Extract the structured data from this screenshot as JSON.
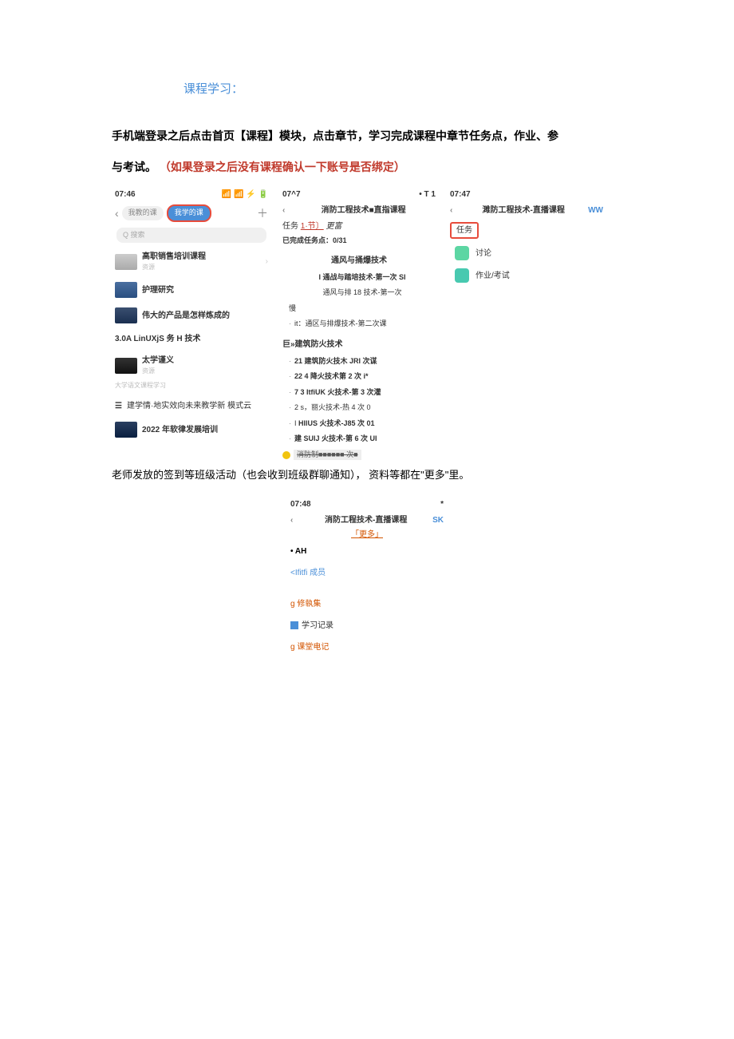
{
  "section_title": "课程学习：",
  "instruction_line1": "手机端登录之后点击首页【课程】模块，点击章节，学习完成课程中章节任务点，作业、参",
  "instruction_line2_a": "与考试。",
  "instruction_line2_b": "（如果登录之后没有课程确认一下账号是否绑定）",
  "screen1": {
    "time": "07:46",
    "signal": "📶 📶 ⚡ 🔋",
    "back": "‹",
    "tab1": "我教的课",
    "tab2": "我学的课",
    "plus": "＋",
    "search": "Q 搜索",
    "c1_title": "高职销售培训课程",
    "c1_sub": "资源",
    "arrow": "›",
    "c2_title": "护理研究",
    "c3_title": "伟大的产品是怎样炼成的",
    "c4_title": "3.0A LinUXjS 务 H 技术",
    "c5_title": "太学谨义",
    "c5_sub": "资源",
    "c5_note": "大学语文课程学习",
    "folder_icon": "☰",
    "folder_text": "建学情·地实效向未来教学新 模式云",
    "c6_title": "2022 年软律发展培训"
  },
  "screen2": {
    "time_l": "07^7",
    "time_r": "• T 1",
    "back": "‹",
    "title": "消防工程技术■直指课程",
    "task_label": "任务",
    "task_link": "1·节〕",
    "task_more": "更富",
    "progress": "已完成任务点：0/31",
    "ch1_h": "通风与捅爆技术",
    "ch1_1": "I 通战与踏培技术-第一次 SI",
    "ch1_2": "通风与排 18 技术-第一次",
    "slow": "慢",
    "ch1_3": "it：通区与排爆技术-第二次课",
    "ch2_h": "巨»建筑防火技术",
    "ch2_1": "21 建筑防火技木 JRI 次谋",
    "ch2_2": "22 4 降火技术第 2 次 i*",
    "ch2_3": "7 3 ItfiUK 火技术-第 3 次灌",
    "ch2_4": "2 s，丽火技术-热 4 次 0",
    "ch2_5": "HIlUS 火技术-J85 次 01",
    "ch2_6": "建 SUIJ 火技术-第 6 次 UI",
    "strike": "消防制■■■■■■ 次■"
  },
  "screen3": {
    "time": "07:47",
    "back": "‹",
    "title": "濉防工程技术-直播课程",
    "ww": "WW",
    "task_btn": "任务",
    "f1": "讨论",
    "f2": "作业/考试"
  },
  "caption": "老师发放的签到等班级活动（也会收到班级群聊通知）， 资料等都在\"更多\"里。",
  "screen4": {
    "time": "07:48",
    "star": "*",
    "back": "‹",
    "title": "消防工程技术-直播课程",
    "sk": "SK",
    "more": "「更多」",
    "r1": "• AH",
    "r2": "<Ifitfi 成员",
    "r3": "g 修執集",
    "r4": "学习记录",
    "r5": "g 课堂电记"
  }
}
